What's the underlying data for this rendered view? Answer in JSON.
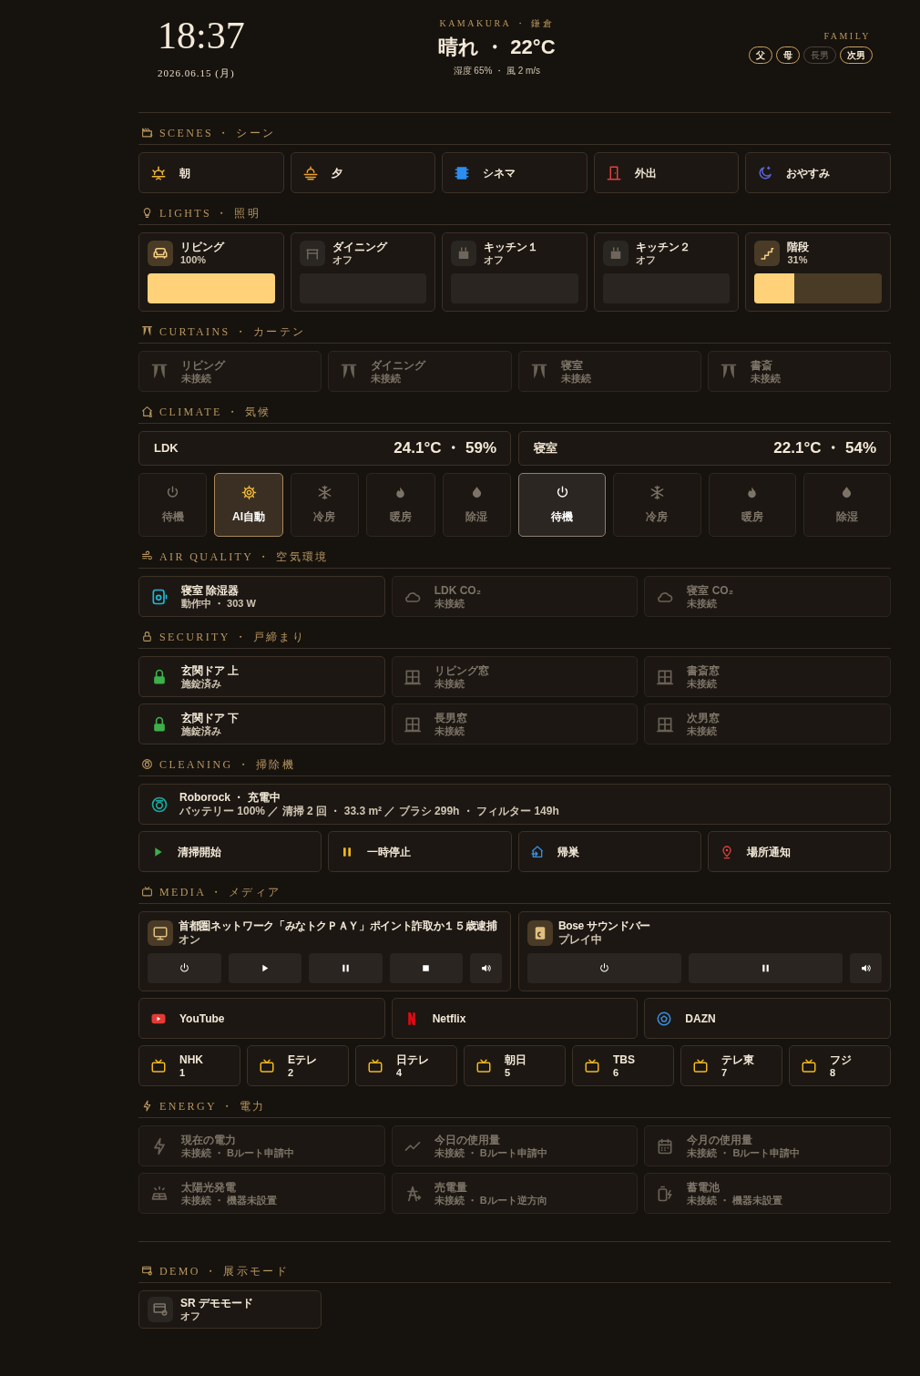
{
  "header": {
    "time": "18:37",
    "date": "2026.06.15 (月)",
    "location": "KAMAKURA ・ 鎌倉",
    "weather": "晴れ ・ 22°C",
    "weather_detail": "湿度 65% ・ 風 2 m/s",
    "family_label": "FAMILY",
    "family": [
      {
        "label": "父",
        "home": true
      },
      {
        "label": "母",
        "home": true
      },
      {
        "label": "長男",
        "home": false
      },
      {
        "label": "次男",
        "home": true
      }
    ]
  },
  "sections": [
    {
      "kind": "scenes",
      "title": "SCENES ・ シーン",
      "items": [
        {
          "label": "朝"
        },
        {
          "label": "夕"
        },
        {
          "label": "シネマ"
        },
        {
          "label": "外出"
        },
        {
          "label": "おやすみ"
        }
      ]
    },
    {
      "kind": "lights",
      "title": "LIGHTS ・ 照明",
      "items": [
        {
          "name": "リビング",
          "status": "100%",
          "on": true,
          "level": 1
        },
        {
          "name": "ダイニング",
          "status": "オフ",
          "on": false,
          "level": 0
        },
        {
          "name": "キッチン１",
          "status": "オフ",
          "on": false,
          "level": 0
        },
        {
          "name": "キッチン２",
          "status": "オフ",
          "on": false,
          "level": 0
        },
        {
          "name": "階段",
          "status": "31%",
          "on": true,
          "level": 0.31
        }
      ]
    },
    {
      "kind": "curtains",
      "title": "CURTAINS ・ カーテン",
      "items": [
        {
          "name": "リビング",
          "status": "未接続",
          "connected": false
        },
        {
          "name": "ダイニング",
          "status": "未接続",
          "connected": false
        },
        {
          "name": "寝室",
          "status": "未接続",
          "connected": false
        },
        {
          "name": "書斎",
          "status": "未接続",
          "connected": false
        }
      ]
    },
    {
      "kind": "climate",
      "title": "CLIMATE ・ 気候",
      "rooms": [
        {
          "name": "LDK",
          "reading": "24.1°C ・ 59%",
          "modes": [
            {
              "kind": "off",
              "label": "待機",
              "selected": false
            },
            {
              "kind": "auto",
              "label": "AI自動",
              "selected": true
            },
            {
              "kind": "cool",
              "label": "冷房",
              "selected": false
            },
            {
              "kind": "heat",
              "label": "暖房",
              "selected": false
            },
            {
              "kind": "dry",
              "label": "除湿",
              "selected": false
            }
          ]
        },
        {
          "name": "寝室",
          "reading": "22.1°C ・ 54%",
          "modes": [
            {
              "kind": "off",
              "label": "待機",
              "selected": true
            },
            {
              "kind": "cool",
              "label": "冷房",
              "selected": false
            },
            {
              "kind": "heat",
              "label": "暖房",
              "selected": false
            },
            {
              "kind": "dry",
              "label": "除湿",
              "selected": false
            }
          ]
        }
      ]
    },
    {
      "kind": "air",
      "title": "AIR QUALITY ・ 空気環境",
      "items": [
        {
          "name": "寝室 除湿器",
          "status": "動作中 ・ 303 W",
          "connected": true
        },
        {
          "name": "LDK CO₂",
          "status": "未接続",
          "connected": false
        },
        {
          "name": "寝室 CO₂",
          "status": "未接続",
          "connected": false
        }
      ]
    },
    {
      "kind": "security",
      "title": "SECURITY ・ 戸締まり",
      "items": [
        {
          "name": "玄関ドア 上",
          "status": "施錠済み",
          "connected": true
        },
        {
          "name": "リビング窓",
          "status": "未接続",
          "connected": false
        },
        {
          "name": "書斎窓",
          "status": "未接続",
          "connected": false
        },
        {
          "name": "玄関ドア 下",
          "status": "施錠済み",
          "connected": true
        },
        {
          "name": "長男窓",
          "status": "未接続",
          "connected": false
        },
        {
          "name": "次男窓",
          "status": "未接続",
          "connected": false
        }
      ]
    },
    {
      "kind": "cleaning",
      "title": "CLEANING ・ 掃除機",
      "status": {
        "name": "Roborock ・ 充電中",
        "detail": "バッテリー 100% ／ 清掃 2 回 ・ 33.3 m² ／ ブラシ 299h ・ フィルター 149h"
      },
      "actions": [
        {
          "label": "清掃開始"
        },
        {
          "label": "一時停止"
        },
        {
          "label": "帰巣"
        },
        {
          "label": "場所通知"
        }
      ]
    },
    {
      "kind": "media",
      "title": "MEDIA ・ メディア",
      "players": [
        {
          "title": "首都圏ネットワーク「みなトクＰＡＹ」ポイント詐取か１５歳逮捕",
          "status": "オン",
          "controls": [
            {
              "kind": "power"
            },
            {
              "kind": "play"
            },
            {
              "kind": "pause"
            },
            {
              "kind": "stop"
            },
            {
              "kind": "volume"
            }
          ]
        },
        {
          "title": "Bose サウンドバー",
          "status": "プレイ中",
          "controls": [
            {
              "kind": "power"
            },
            {
              "kind": "pause"
            },
            {
              "kind": "volume"
            }
          ]
        }
      ],
      "apps": [
        {
          "label": "YouTube"
        },
        {
          "label": "Netflix"
        },
        {
          "label": "DAZN"
        }
      ],
      "channels": [
        {
          "name": "NHK",
          "number": "1"
        },
        {
          "name": "Eテレ",
          "number": "2"
        },
        {
          "name": "日テレ",
          "number": "4"
        },
        {
          "name": "朝日",
          "number": "5"
        },
        {
          "name": "TBS",
          "number": "6"
        },
        {
          "name": "テレ東",
          "number": "7"
        },
        {
          "name": "フジ",
          "number": "8"
        }
      ]
    },
    {
      "kind": "energy",
      "title": "ENERGY ・ 電力",
      "items": [
        {
          "name": "現在の電力",
          "status": "未接続 ・ Bルート申請中",
          "connected": false
        },
        {
          "name": "今日の使用量",
          "status": "未接続 ・ Bルート申請中",
          "connected": false
        },
        {
          "name": "今月の使用量",
          "status": "未接続 ・ Bルート申請中",
          "connected": false
        },
        {
          "name": "太陽光発電",
          "status": "未接続 ・ 機器未設置",
          "connected": false
        },
        {
          "name": "売電量",
          "status": "未接続 ・ Bルート逆方向",
          "connected": false
        },
        {
          "name": "蓄電池",
          "status": "未接続 ・ 機器未設置",
          "connected": false
        }
      ]
    },
    {
      "kind": "demo",
      "title": "DEMO ・ 展示モード",
      "items": [
        {
          "name": "SR デモモード",
          "status": "オフ",
          "on": false
        }
      ]
    }
  ]
}
